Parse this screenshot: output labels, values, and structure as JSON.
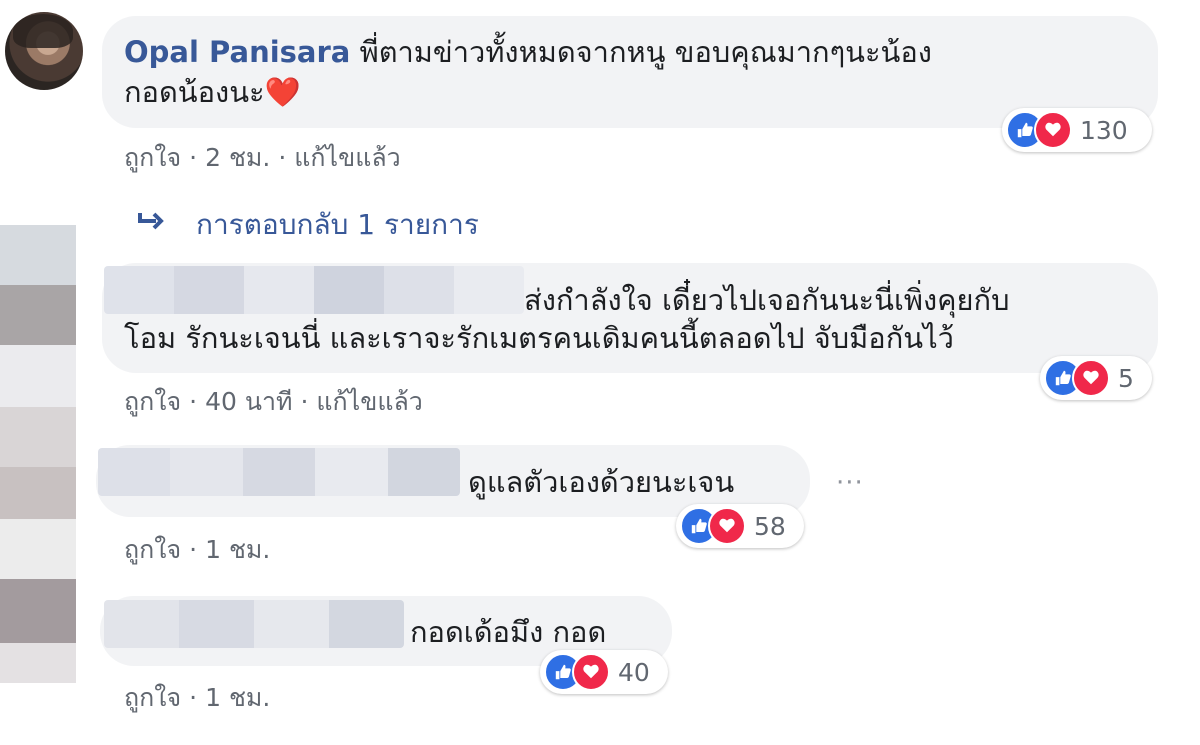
{
  "comments": [
    {
      "author": "Opal Panisara",
      "text_line1": "พี่ตามข่าวทั้งหมดจากหนู ขอบคุณมากๆนะน้อง",
      "text_line2": "กอดน้องนะ❤️",
      "like_label": "ถูกใจ",
      "time": "2 ชม.",
      "edited": "แก้ไขแล้ว",
      "reactions": 130
    },
    {
      "text_line1": "ส่งกำลังใจ เดี๋ยวไปเจอกันนะนี่เพิ่งคุยกับ",
      "text_line2": "โอม รักนะเจนนี่ และเราจะรักเมตรคนเดิมคนนี้ตลอดไป จับมือกันไว้",
      "like_label": "ถูกใจ",
      "time": "40 นาที",
      "edited": "แก้ไขแล้ว",
      "reactions": 5
    },
    {
      "text_line1": "ดูแลตัวเองด้วยนะเจน",
      "like_label": "ถูกใจ",
      "time": "1 ชม.",
      "reactions": 58
    },
    {
      "text_line1": "กอดเด้อมึง กอด",
      "like_label": "ถูกใจ",
      "time": "1 ชม.",
      "reactions": 40
    }
  ],
  "replies_link": "การตอบกลับ 1 รายการ",
  "more_options": "···",
  "colors": {
    "link": "#385898",
    "bubble": "#f2f3f5",
    "meta": "#616770",
    "like": "#2f6fe4",
    "love": "#f0284a"
  },
  "icons": {
    "reply_arrow": "reply-arrow-icon",
    "like": "thumbs-up-icon",
    "love": "heart-icon"
  }
}
